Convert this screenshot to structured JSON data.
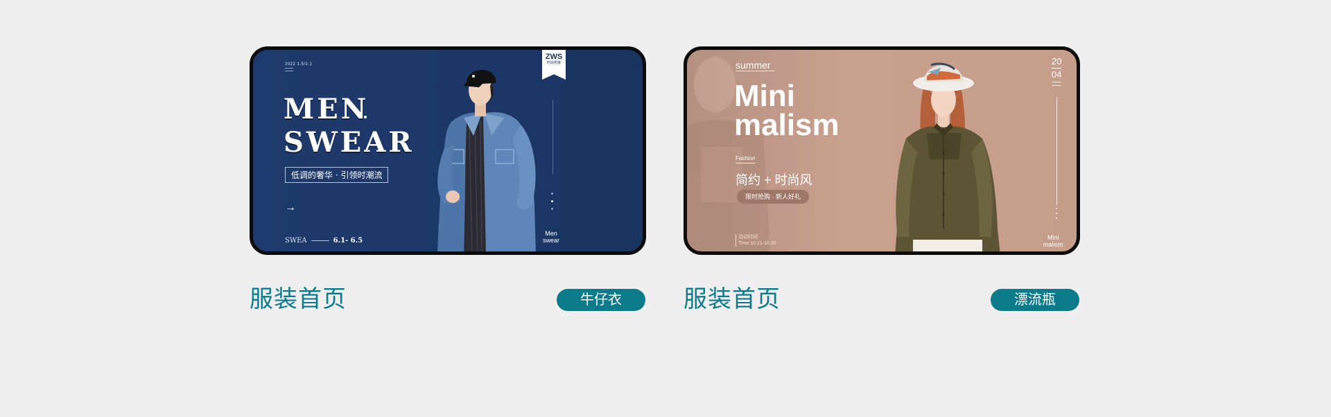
{
  "card1": {
    "date": "2022  1.5/2.1",
    "title_line1": "MEN",
    "title_line2": "SWEAR",
    "subtitle": "低调的奢华 · 引领时潮流",
    "arrow": "→",
    "bottom_left": "SWEA",
    "bottom_dates": "6.1- 6.5",
    "corner_line1": "Men",
    "corner_line2": "swear",
    "ribbon_big": "ZWS",
    "ribbon_small": "时尚男装"
  },
  "card2": {
    "summer": "summer",
    "title_line1": "Mini",
    "title_line2": "malism",
    "fashion": "Fashion",
    "subtitle": "简约 + 时尚风",
    "pill": "限时抢购 · 新人好礼",
    "bottom_line1": "活动时间",
    "bottom_line2": "Time:10.21-10.30",
    "year_top": "20",
    "year_bottom": "04",
    "corner_line1": "Mini",
    "corner_line2": "malism"
  },
  "captions": {
    "left_title": "服装首页",
    "left_tag": "牛仔衣",
    "right_title": "服装首页",
    "right_tag": "漂流瓶"
  },
  "colors": {
    "accent": "#0d7a8c",
    "card1_bg": "#1f3a6c",
    "card2_bg": "#c69d8b",
    "page_bg": "#efefef"
  }
}
